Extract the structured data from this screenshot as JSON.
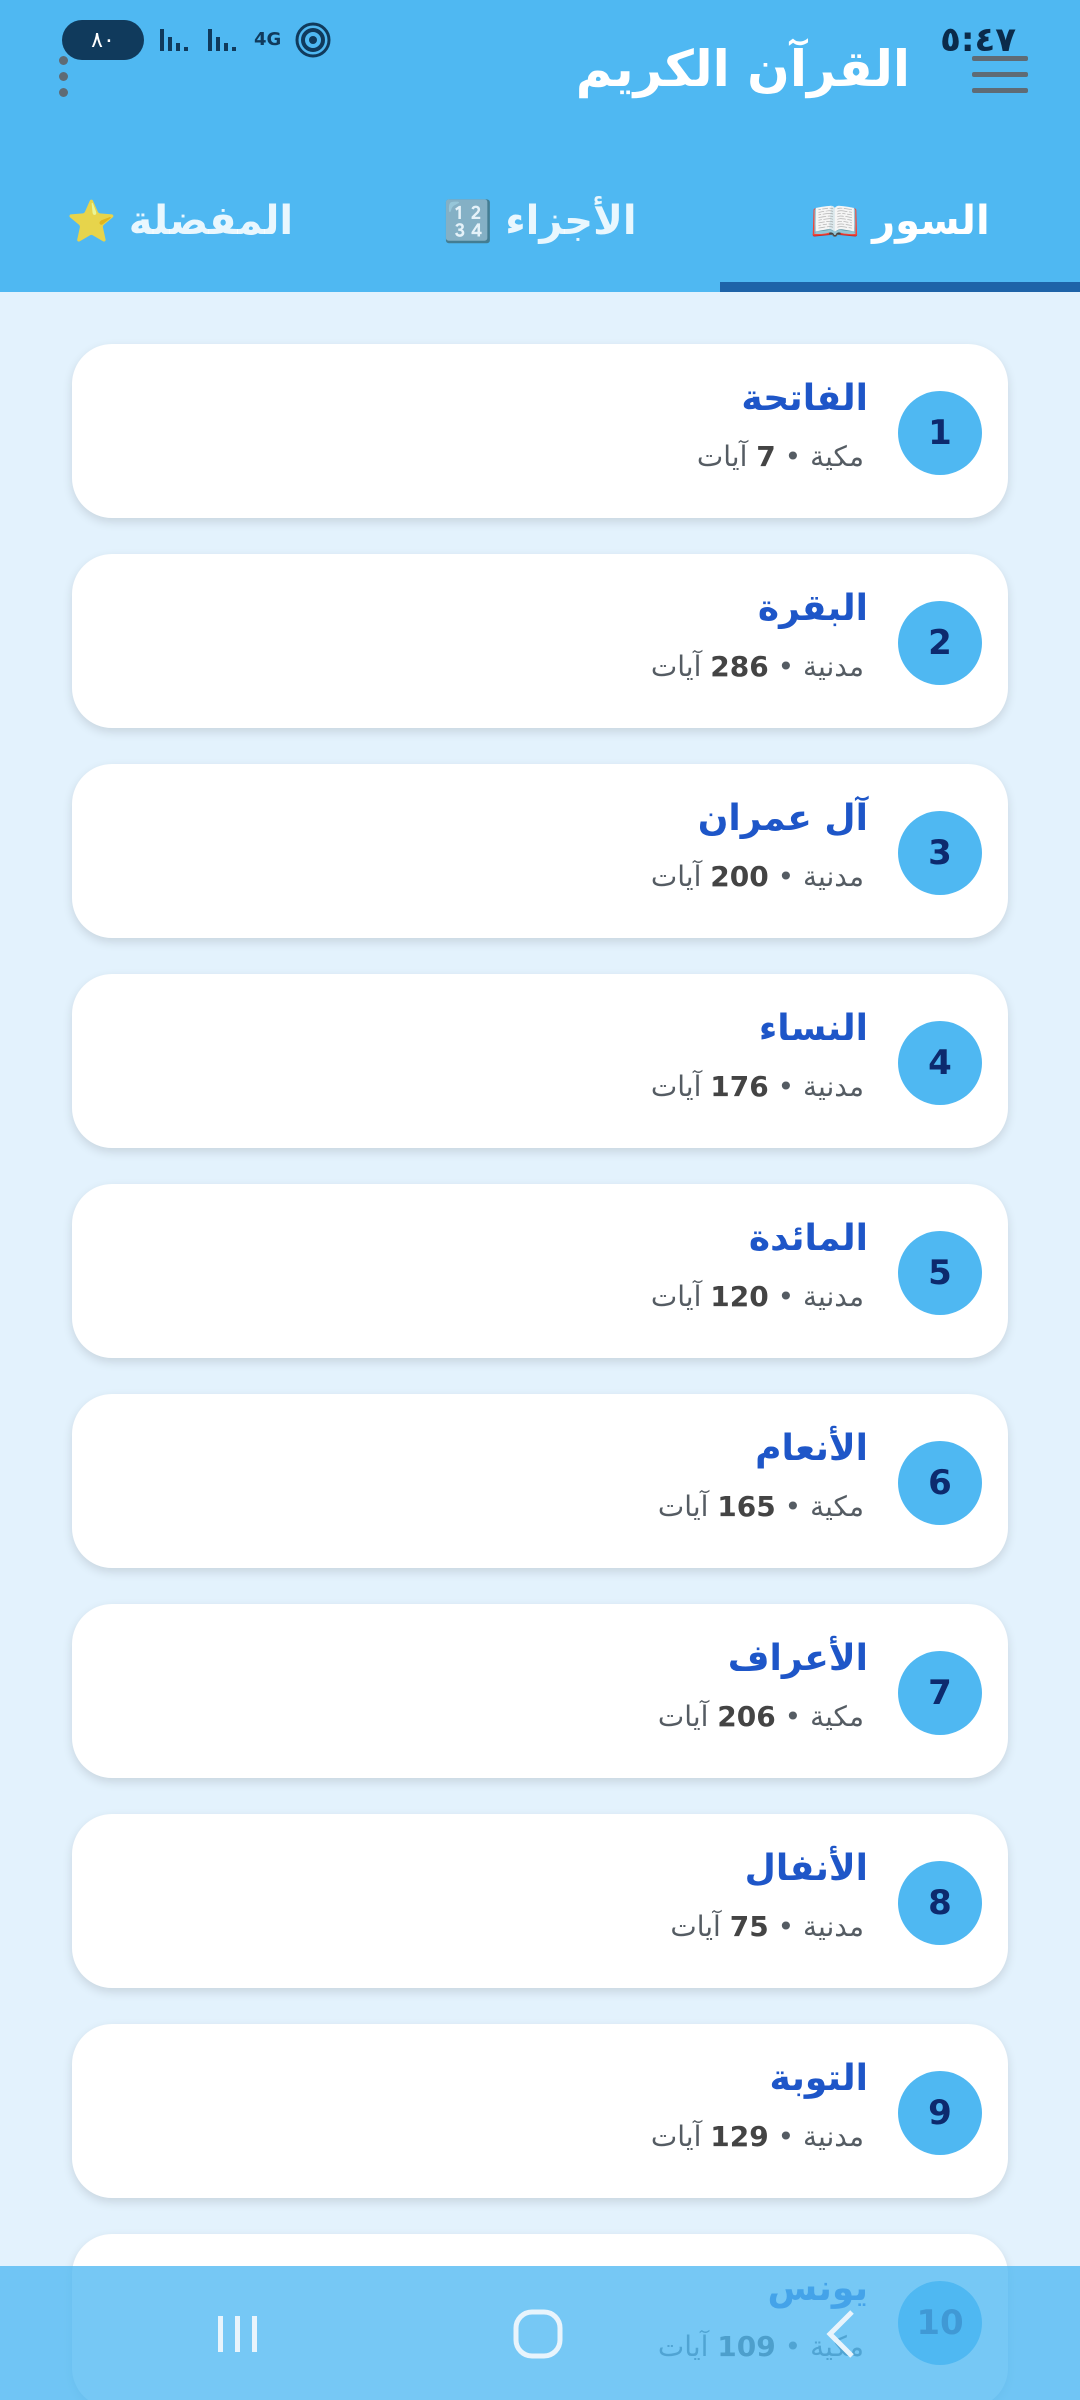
{
  "status": {
    "time": "٥:٤٧",
    "battery": "٨٠",
    "network": "4G"
  },
  "header": {
    "title": "القرآن الكريم"
  },
  "tabs": [
    {
      "label": "السور",
      "icon": "📖",
      "active": true
    },
    {
      "label": "الأجزاء",
      "icon": "🔢",
      "active": false
    },
    {
      "label": "المفضلة",
      "icon": "⭐",
      "active": false
    }
  ],
  "surahs": [
    {
      "number": "1",
      "name": "الفاتحة",
      "type": "مكية",
      "ayat": "7",
      "ayat_label": "آيات"
    },
    {
      "number": "2",
      "name": "البقرة",
      "type": "مدنية",
      "ayat": "286",
      "ayat_label": "آيات"
    },
    {
      "number": "3",
      "name": "آل عمران",
      "type": "مدنية",
      "ayat": "200",
      "ayat_label": "آيات"
    },
    {
      "number": "4",
      "name": "النساء",
      "type": "مدنية",
      "ayat": "176",
      "ayat_label": "آيات"
    },
    {
      "number": "5",
      "name": "المائدة",
      "type": "مدنية",
      "ayat": "120",
      "ayat_label": "آيات"
    },
    {
      "number": "6",
      "name": "الأنعام",
      "type": "مكية",
      "ayat": "165",
      "ayat_label": "آيات"
    },
    {
      "number": "7",
      "name": "الأعراف",
      "type": "مكية",
      "ayat": "206",
      "ayat_label": "آيات"
    },
    {
      "number": "8",
      "name": "الأنفال",
      "type": "مدنية",
      "ayat": "75",
      "ayat_label": "آيات"
    },
    {
      "number": "9",
      "name": "التوبة",
      "type": "مدنية",
      "ayat": "129",
      "ayat_label": "آيات"
    },
    {
      "number": "10",
      "name": "يونس",
      "type": "مكية",
      "ayat": "109",
      "ayat_label": "آيات"
    }
  ],
  "separator": "•",
  "colors": {
    "primary": "#4fb8f2",
    "tab_indicator": "#1e63a8",
    "surah_name": "#1e56c8",
    "number_text": "#0d2a6e",
    "background": "#e3f2fd"
  }
}
